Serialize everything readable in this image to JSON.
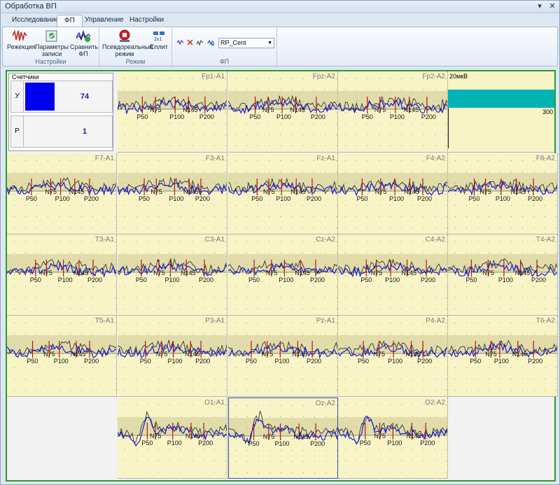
{
  "window": {
    "title": "Обработка ВП",
    "controls": [
      "▾",
      "✕"
    ]
  },
  "tabs": [
    {
      "label": "Исследование",
      "active": false
    },
    {
      "label": "ФП",
      "active": true
    },
    {
      "label": "Управление",
      "active": false
    },
    {
      "label": "Настройки",
      "active": false
    }
  ],
  "ribbon": {
    "groups": [
      {
        "label": "Настройки",
        "buttons": [
          {
            "label": "Режекция",
            "icon": "notch-filter-icon"
          },
          {
            "label": "Параметры записи",
            "icon": "record-params-icon"
          },
          {
            "label": "Сравнить ФП",
            "icon": "compare-icon"
          }
        ]
      },
      {
        "label": "Режим",
        "buttons": [
          {
            "label": "Псевдореальный режим",
            "icon": "pseudo-realtime-icon"
          },
          {
            "label": "Сплит",
            "icon": "split-icon"
          }
        ]
      },
      {
        "label": "ФП",
        "combo_value": "RP_Cent",
        "icons": [
          "wave-arrow-icon",
          "peak-marker-icon",
          "peak-list-icon",
          "peak-sort-icon"
        ]
      }
    ]
  },
  "counters": {
    "title": "Счетчики",
    "rows": [
      {
        "key": "У",
        "value": "74"
      },
      {
        "key": "Р",
        "value": "1"
      }
    ]
  },
  "scale": {
    "label": "20мкВ",
    "value": "300"
  },
  "peak_names": [
    "P50",
    "N75",
    "P100",
    "N145",
    "P200"
  ],
  "panels": [
    {
      "label": "Fp1-A1",
      "row": 0,
      "col": 1,
      "peaks": [
        "P50",
        "N75",
        "P100",
        "N145",
        "P200"
      ]
    },
    {
      "label": "Fpz-A2",
      "row": 0,
      "col": 2,
      "peaks": [
        "P50",
        "N75",
        "P100",
        "N145",
        "P200"
      ]
    },
    {
      "label": "Fp2-A2",
      "row": 0,
      "col": 3,
      "peaks": [
        "P50",
        "N75",
        "P100",
        "N145",
        "P200"
      ]
    },
    {
      "label": "F7-A1",
      "row": 1,
      "col": 0,
      "peaks": [
        "P50",
        "N75",
        "P100",
        "N145",
        "P200"
      ]
    },
    {
      "label": "F3-A1",
      "row": 1,
      "col": 1,
      "peaks": [
        "P50",
        "N75",
        "P100",
        "N145",
        "P200"
      ]
    },
    {
      "label": "Fz-A1",
      "row": 1,
      "col": 2,
      "peaks": [
        "P50",
        "N75",
        "P100",
        "N145",
        "P200"
      ]
    },
    {
      "label": "F4-A2",
      "row": 1,
      "col": 3,
      "peaks": [
        "P50",
        "N75",
        "P100",
        "N145",
        "P200"
      ]
    },
    {
      "label": "F8-A2",
      "row": 1,
      "col": 4,
      "peaks": [
        "P50",
        "N75",
        "P100",
        "N145",
        "P200"
      ]
    },
    {
      "label": "T3-A1",
      "row": 2,
      "col": 0,
      "peaks": [
        "P50",
        "N75",
        "P100",
        "N145",
        "P200"
      ]
    },
    {
      "label": "C3-A1",
      "row": 2,
      "col": 1,
      "peaks": [
        "P50",
        "N75",
        "P100",
        "N145",
        "P200"
      ]
    },
    {
      "label": "Cz-A2",
      "row": 2,
      "col": 2,
      "peaks": [
        "P50",
        "N75",
        "P100",
        "N145",
        "P200"
      ]
    },
    {
      "label": "C4-A2",
      "row": 2,
      "col": 3,
      "peaks": [
        "P50",
        "N75",
        "P100",
        "N145",
        "P200"
      ]
    },
    {
      "label": "T4-A2",
      "row": 2,
      "col": 4,
      "peaks": [
        "P50",
        "N75",
        "P100",
        "N145",
        "P200"
      ]
    },
    {
      "label": "T5-A1",
      "row": 3,
      "col": 0,
      "peaks": [
        "P50",
        "N75",
        "P100",
        "N145",
        "P200"
      ]
    },
    {
      "label": "P3-A1",
      "row": 3,
      "col": 1,
      "peaks": [
        "P50",
        "N75",
        "P100",
        "N145",
        "P200"
      ]
    },
    {
      "label": "Pz-A1",
      "row": 3,
      "col": 2,
      "peaks": [
        "P50",
        "N75",
        "P100",
        "N145",
        "P200"
      ]
    },
    {
      "label": "P4-A2",
      "row": 3,
      "col": 3,
      "peaks": [
        "P50",
        "N75",
        "P100",
        "N145",
        "P200"
      ]
    },
    {
      "label": "T6-A2",
      "row": 3,
      "col": 4,
      "peaks": [
        "P50",
        "N75",
        "P100",
        "N145",
        "P200"
      ]
    },
    {
      "label": "O1-A1",
      "row": 4,
      "col": 1,
      "peaks": [
        "P50",
        "N75",
        "P100",
        "N145",
        "P200"
      ]
    },
    {
      "label": "Oz-A2",
      "row": 4,
      "col": 2,
      "selected": true,
      "peaks": [
        "P50",
        "N75",
        "P100",
        "N145",
        "P200"
      ]
    },
    {
      "label": "O2-A2",
      "row": 4,
      "col": 3,
      "peaks": [
        "P50",
        "N75",
        "P100",
        "N145",
        "P200"
      ]
    }
  ],
  "colors": {
    "panel_bg": "#f8f4c6",
    "band": "#e1dcaa",
    "trace_blue": "#1a1ad8",
    "trace_dark": "#333333",
    "marker": "#b01818",
    "counter_bar": "#0000f0",
    "scale_bar": "#00b4b4",
    "frame": "#2e9a2e"
  }
}
